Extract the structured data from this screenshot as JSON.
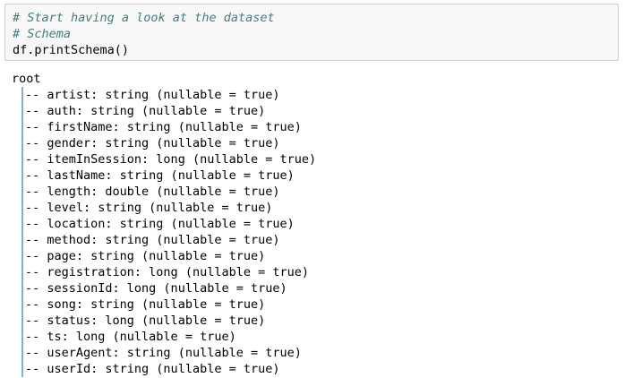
{
  "input_cell": {
    "comment_1": "# Start having a look at the dataset",
    "comment_2": "# Schema",
    "code": "df.printSchema()"
  },
  "output": {
    "root": "root",
    "prefix": "-- ",
    "fields": [
      "artist: string (nullable = true)",
      "auth: string (nullable = true)",
      "firstName: string (nullable = true)",
      "gender: string (nullable = true)",
      "itemInSession: long (nullable = true)",
      "lastName: string (nullable = true)",
      "length: double (nullable = true)",
      "level: string (nullable = true)",
      "location: string (nullable = true)",
      "method: string (nullable = true)",
      "page: string (nullable = true)",
      "registration: long (nullable = true)",
      "sessionId: long (nullable = true)",
      "song: string (nullable = true)",
      "status: long (nullable = true)",
      "ts: long (nullable = true)",
      "userAgent: string (nullable = true)",
      "userId: string (nullable = true)"
    ]
  },
  "colors": {
    "comment": "#408080",
    "cell_background": "#f7f7f7",
    "cell_border": "#cfcfcf",
    "tree_bar": "#7fb0d8"
  }
}
